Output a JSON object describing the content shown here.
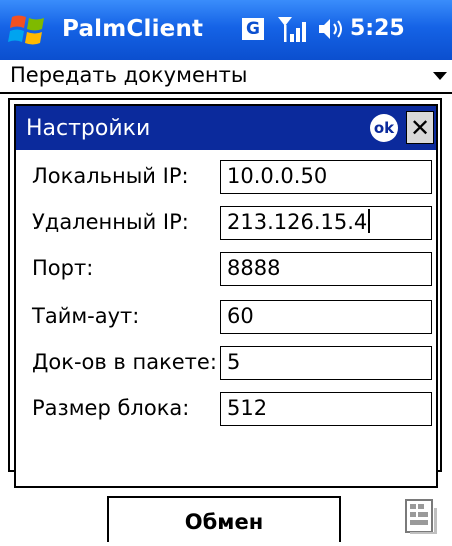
{
  "statusbar": {
    "app_title": "PalmClient",
    "network_badge": "G",
    "time": "5:25",
    "icons": [
      "windows-start-icon",
      "signal-icon",
      "speaker-icon"
    ]
  },
  "dropdown": {
    "label": "Передать документы"
  },
  "dialog": {
    "title": "Настройки",
    "ok_label": "ok",
    "close_label": "✕",
    "fields": [
      {
        "label": "Локальный IP:",
        "value": "10.0.0.50"
      },
      {
        "label": "Удаленный IP:",
        "value": "213.126.15.4"
      },
      {
        "label": "Порт:",
        "value": "8888"
      },
      {
        "label": "Тайм-аут:",
        "value": "60"
      },
      {
        "label": "Док-ов в пакете:",
        "value": "5"
      },
      {
        "label": "Размер блока:",
        "value": "512"
      }
    ]
  },
  "bottom": {
    "exchange_label": "Обмен",
    "sip_icon": "keyboard-input-panel-icon"
  },
  "colors": {
    "titlebar": "#1563e6",
    "dialog_titlebar": "#0b2a9c"
  }
}
